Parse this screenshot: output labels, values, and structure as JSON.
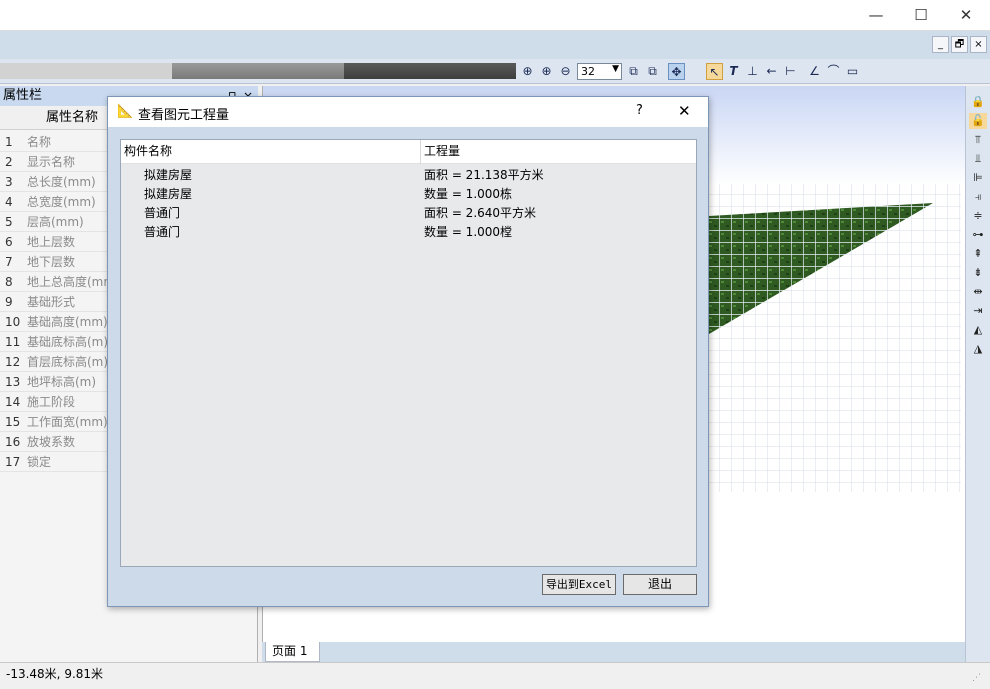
{
  "window": {
    "minimize": "—",
    "maximize": "☐",
    "close": "✕"
  },
  "mdi": {
    "minimize": "_",
    "restore": "🗗",
    "close": "×"
  },
  "toolbar": {
    "zoom_value": "32"
  },
  "property_panel": {
    "title": "属性栏",
    "column_header": "属性名称",
    "rows": [
      {
        "num": "1",
        "name": "名称"
      },
      {
        "num": "2",
        "name": "显示名称"
      },
      {
        "num": "3",
        "name": "总长度(mm)"
      },
      {
        "num": "4",
        "name": "总宽度(mm)"
      },
      {
        "num": "5",
        "name": "层高(mm)"
      },
      {
        "num": "6",
        "name": "地上层数"
      },
      {
        "num": "7",
        "name": "地下层数"
      },
      {
        "num": "8",
        "name": "地上总高度(mm)"
      },
      {
        "num": "9",
        "name": "基础形式"
      },
      {
        "num": "10",
        "name": "基础高度(mm)"
      },
      {
        "num": "11",
        "name": "基础底标高(m)"
      },
      {
        "num": "12",
        "name": "首层底标高(m)"
      },
      {
        "num": "13",
        "name": "地坪标高(m)"
      },
      {
        "num": "14",
        "name": "施工阶段"
      },
      {
        "num": "15",
        "name": "工作面宽(mm)"
      },
      {
        "num": "16",
        "name": "放坡系数"
      },
      {
        "num": "17",
        "name": "锁定"
      }
    ]
  },
  "page_tab": "页面 1",
  "status": "-13.48米, 9.81米",
  "dialog": {
    "title": "查看图元工程量",
    "help": "?",
    "close": "✕",
    "columns": [
      "构件名称",
      "工程量"
    ],
    "rows": [
      {
        "name": "拟建房屋",
        "quantity": "面积 = 21.138平方米"
      },
      {
        "name": "拟建房屋",
        "quantity": "数量 = 1.000栋"
      },
      {
        "name": "普通门",
        "quantity": "面积 = 2.640平方米"
      },
      {
        "name": "普通门",
        "quantity": "数量 = 1.000樘"
      }
    ],
    "export_button": "导出到Excel",
    "exit_button": "退出"
  }
}
